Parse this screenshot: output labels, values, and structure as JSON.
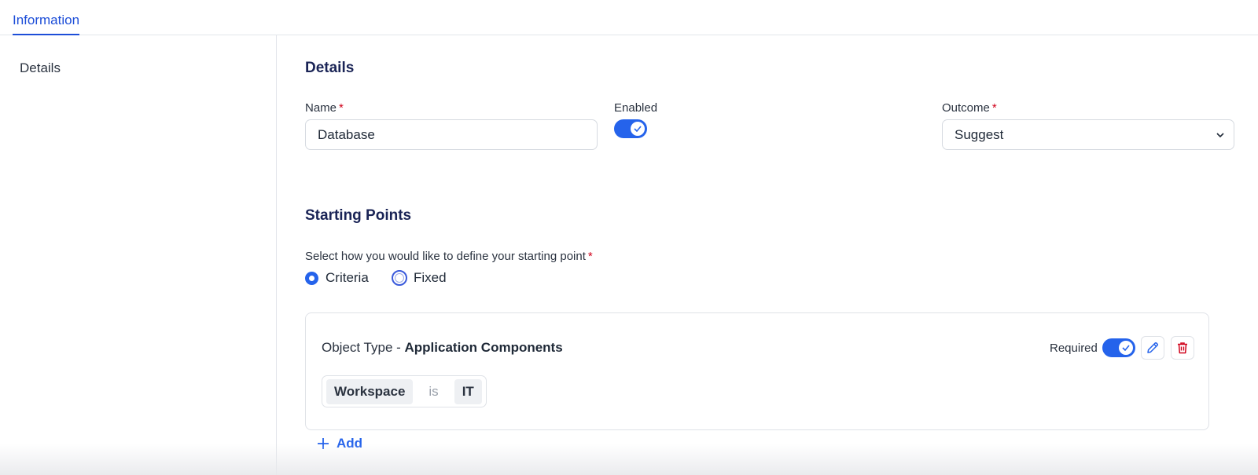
{
  "tabs": [
    {
      "label": "Information",
      "active": true
    }
  ],
  "sidebar": {
    "items": [
      {
        "label": "Details"
      }
    ]
  },
  "details": {
    "title": "Details",
    "name_label": "Name",
    "name_value": "Database",
    "enabled_label": "Enabled",
    "enabled": true,
    "outcome_label": "Outcome",
    "outcome_value": "Suggest",
    "required_mark": "*"
  },
  "starting_points": {
    "title": "Starting Points",
    "prompt": "Select how you would like to define your starting point",
    "options": [
      {
        "label": "Criteria",
        "selected": true
      },
      {
        "label": "Fixed",
        "selected": false
      }
    ],
    "card": {
      "prefix": "Object Type - ",
      "object_type": "Application Components",
      "required_label": "Required",
      "required": true,
      "criteria": {
        "field": "Workspace",
        "operator": "is",
        "value": "IT"
      }
    },
    "add_label": "Add"
  },
  "colors": {
    "accent": "#2563eb",
    "heading": "#1a2456",
    "danger": "#d0021b"
  }
}
